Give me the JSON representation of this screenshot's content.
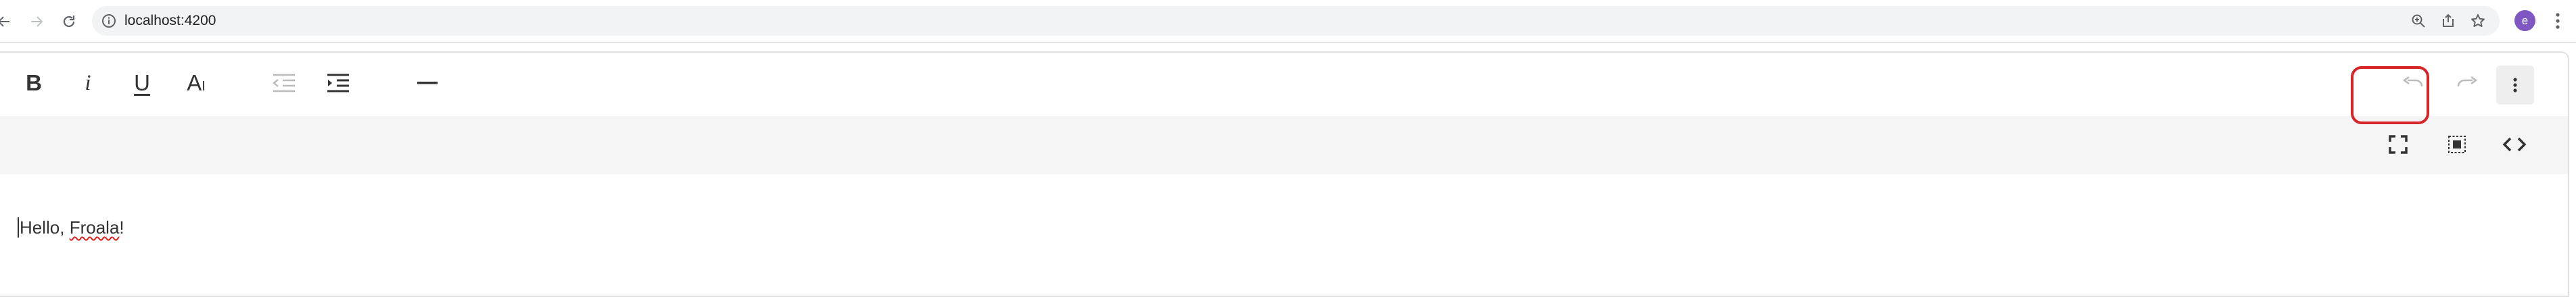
{
  "browser": {
    "url": "localhost:4200",
    "avatar_letter": "e",
    "avatar_color": "#7e57c2"
  },
  "toolbar": {
    "bold_label": "B",
    "italic_label": "i",
    "underline_label": "U",
    "text_format_label": "A",
    "text_format_sub": "I"
  },
  "editor": {
    "content_before": "Hello, ",
    "content_misspelled": "Froala",
    "content_after": "!"
  },
  "highlight_color": "#d62428"
}
